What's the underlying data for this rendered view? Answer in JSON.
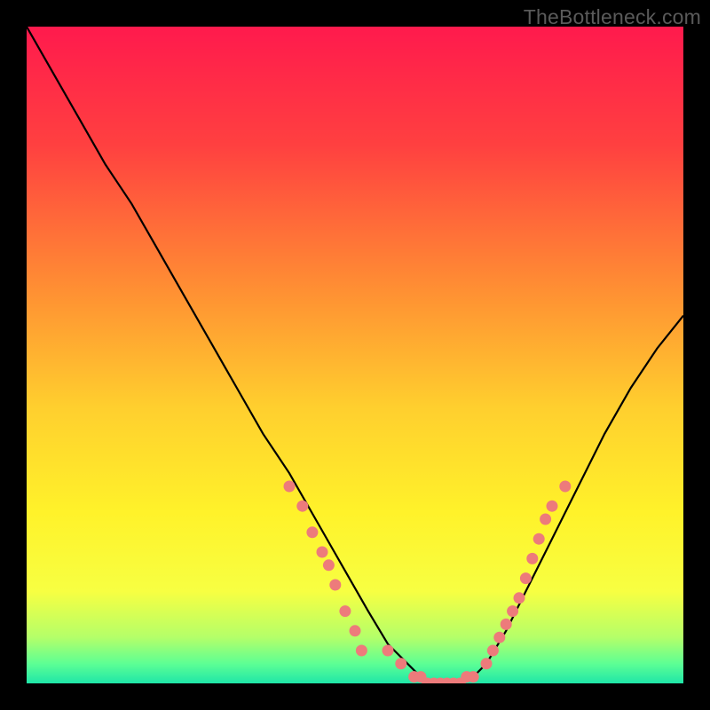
{
  "watermark": "TheBottleneck.com",
  "chart_data": {
    "type": "line",
    "title": "",
    "xlabel": "",
    "ylabel": "",
    "xlim": [
      0,
      100
    ],
    "ylim": [
      0,
      100
    ],
    "grid": false,
    "legend": false,
    "background_gradient": {
      "stops": [
        {
          "offset": 0.0,
          "color": "#ff1a4d"
        },
        {
          "offset": 0.18,
          "color": "#ff4040"
        },
        {
          "offset": 0.4,
          "color": "#ff8f33"
        },
        {
          "offset": 0.58,
          "color": "#ffcf2e"
        },
        {
          "offset": 0.74,
          "color": "#fff22a"
        },
        {
          "offset": 0.86,
          "color": "#f7ff42"
        },
        {
          "offset": 0.93,
          "color": "#b4ff69"
        },
        {
          "offset": 0.97,
          "color": "#5dff94"
        },
        {
          "offset": 1.0,
          "color": "#1fe6a8"
        }
      ]
    },
    "series": [
      {
        "name": "curve",
        "type": "line",
        "color": "#000000",
        "x": [
          0,
          4,
          8,
          12,
          16,
          20,
          24,
          28,
          32,
          36,
          40,
          44,
          48,
          52,
          55,
          58,
          60,
          62,
          64,
          66,
          68,
          70,
          73,
          76,
          80,
          84,
          88,
          92,
          96,
          100
        ],
        "y": [
          100,
          93,
          86,
          79,
          73,
          66,
          59,
          52,
          45,
          38,
          32,
          25,
          18,
          11,
          6,
          3,
          1,
          0,
          0,
          0,
          1,
          3,
          8,
          14,
          22,
          30,
          38,
          45,
          51,
          56
        ]
      },
      {
        "name": "left-cluster",
        "type": "scatter",
        "color": "#ed7b7b",
        "x": [
          40,
          42,
          43.5,
          45,
          46,
          47,
          48.5,
          50,
          51
        ],
        "y": [
          30,
          27,
          23,
          20,
          18,
          15,
          11,
          8,
          5
        ]
      },
      {
        "name": "bottom-cluster",
        "type": "scatter",
        "color": "#ed7b7b",
        "x": [
          55,
          57,
          59,
          60,
          61,
          62,
          63,
          64,
          65,
          66,
          67,
          68,
          70,
          71
        ],
        "y": [
          5,
          3,
          1,
          1,
          0,
          0,
          0,
          0,
          0,
          0,
          1,
          1,
          3,
          5
        ]
      },
      {
        "name": "right-cluster",
        "type": "scatter",
        "color": "#ed7b7b",
        "x": [
          72,
          73,
          74,
          75,
          76,
          77,
          78,
          79,
          80,
          82
        ],
        "y": [
          7,
          9,
          11,
          13,
          16,
          19,
          22,
          25,
          27,
          30
        ]
      }
    ]
  }
}
